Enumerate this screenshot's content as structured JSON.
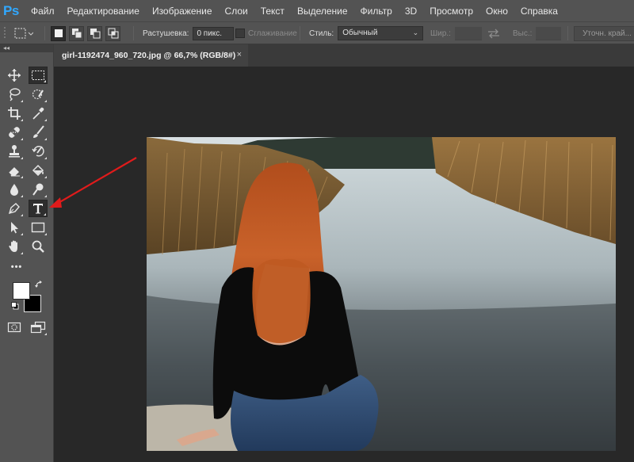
{
  "app": {
    "logo": "Ps"
  },
  "menu": [
    {
      "label": "Файл"
    },
    {
      "label": "Редактирование"
    },
    {
      "label": "Изображение"
    },
    {
      "label": "Слои"
    },
    {
      "label": "Текст"
    },
    {
      "label": "Выделение"
    },
    {
      "label": "Фильтр"
    },
    {
      "label": "3D"
    },
    {
      "label": "Просмотр"
    },
    {
      "label": "Окно"
    },
    {
      "label": "Справка"
    }
  ],
  "options": {
    "feather_label": "Растушевка:",
    "feather_value": "0 пикс.",
    "antialias_label": "Сглаживание",
    "style_label": "Стиль:",
    "style_value": "Обычный",
    "width_label": "Шир.:",
    "height_label": "Выс.:",
    "refine_label": "Уточн. край..."
  },
  "document": {
    "tab_title": "girl-1192474_960_720.jpg @ 66,7% (RGB/8#)",
    "close_glyph": "×"
  },
  "toolbar": {
    "collapse_glyph": "◂◂",
    "more_glyph": "•••"
  },
  "colors": {
    "ui_bg": "#535353",
    "workspace_bg": "#282828",
    "ps_blue": "#31a8ff",
    "arrow_red": "#e01b1b",
    "foreground": "#ffffff",
    "background": "#000000"
  }
}
